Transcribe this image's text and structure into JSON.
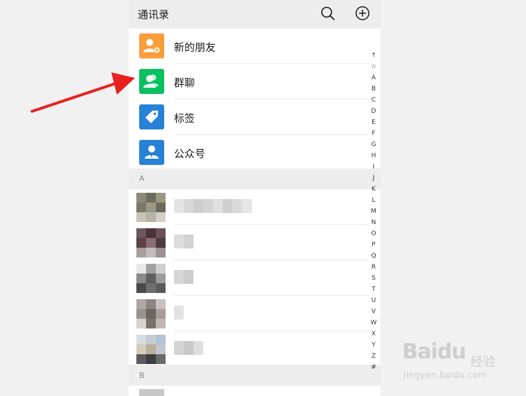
{
  "header": {
    "title": "通讯录"
  },
  "menu": {
    "items": [
      {
        "label": "新的朋友",
        "icon": "add-friend-icon",
        "color": "#fa9d3b"
      },
      {
        "label": "群聊",
        "icon": "group-chat-icon",
        "color": "#07c160"
      },
      {
        "label": "标签",
        "icon": "tag-icon",
        "color": "#2782d7"
      },
      {
        "label": "公众号",
        "icon": "official-account-icon",
        "color": "#2782d7"
      }
    ]
  },
  "sections": [
    {
      "letter": "A"
    },
    {
      "letter": "B"
    }
  ],
  "index_bar": [
    "↑",
    "☆",
    "A",
    "B",
    "C",
    "D",
    "E",
    "F",
    "G",
    "H",
    "I",
    "J",
    "K",
    "L",
    "M",
    "N",
    "O",
    "P",
    "Q",
    "R",
    "S",
    "T",
    "U",
    "V",
    "W",
    "X",
    "Y",
    "Z",
    "#"
  ],
  "watermark": {
    "logo": "Baidu",
    "jingyan": "经验",
    "url": "jingyan.baidu.com"
  },
  "annotation": {
    "arrow_color": "#e8201e"
  }
}
